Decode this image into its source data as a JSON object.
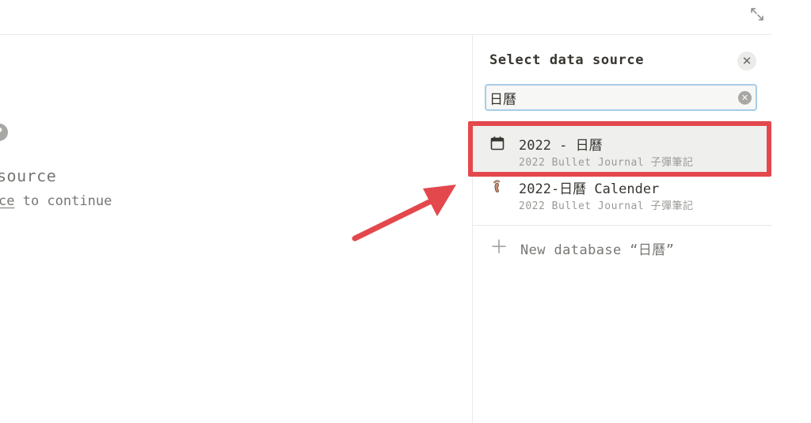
{
  "empty_state": {
    "title_visible": "source",
    "hint_link_visible": "ce",
    "hint_rest": " to continue"
  },
  "panel": {
    "title": "Select data source",
    "search": {
      "value": "日曆"
    },
    "results": [
      {
        "icon": "calendar-icon",
        "title": "2022 - 日曆",
        "subtitle": "2022 Bullet Journal 子彈筆記",
        "highlighted": true
      },
      {
        "icon": "footprints-icon",
        "title": "2022-日曆 Calender",
        "subtitle": "2022 Bullet Journal 子彈筆記",
        "highlighted": false
      }
    ],
    "new_database_label": "New database “日曆”"
  },
  "colors": {
    "annotation_red": "#e3484d",
    "search_focus_border": "#a6cde6"
  }
}
